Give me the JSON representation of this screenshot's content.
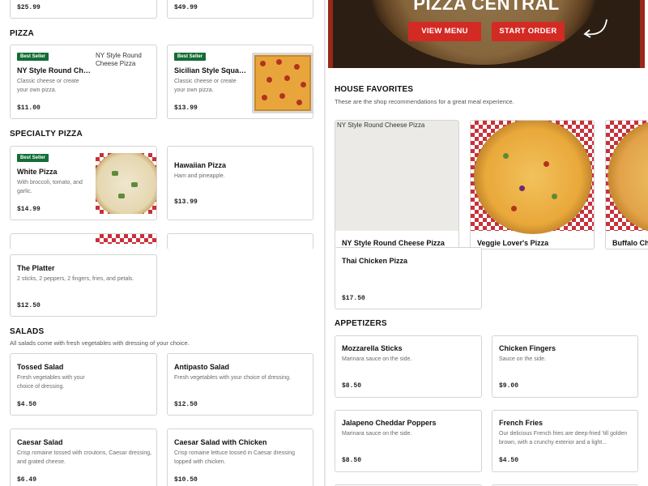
{
  "top_row": {
    "price_left": "$25.99",
    "price_right": "$49.99"
  },
  "pizza": {
    "title": "PIZZA",
    "items": [
      {
        "badge": "Best Seller",
        "name": "NY Style Round Chee...",
        "desc": "Classic cheese or create your own pizza.",
        "price": "$11.00",
        "img_alt": "NY Style Round Cheese Pizza"
      },
      {
        "badge": "Best Seller",
        "name": "Sicilian Style Square...",
        "desc": "Classic cheese or create your own pizza.",
        "price": "$13.99"
      }
    ]
  },
  "specialty": {
    "title": "SPECIALTY PIZZA",
    "items": [
      {
        "badge": "Best Seller",
        "name": "White Pizza",
        "desc": "With broccoli, tomato, and garlic.",
        "price": "$14.99"
      },
      {
        "name": "Hawaiian Pizza",
        "desc": "Ham and pineapple.",
        "price": "$13.99"
      },
      {
        "name": "The Platter",
        "desc": "2 sticks, 2 peppers, 2 fingers, fries, and petals.",
        "price": "$12.50"
      }
    ]
  },
  "salads": {
    "title": "SALADS",
    "subtitle": "All salads come with fresh vegetables with dressing of your choice.",
    "items": [
      {
        "name": "Tossed Salad",
        "desc": "Fresh vegetables with your choice of dressing.",
        "price": "$4.50"
      },
      {
        "name": "Antipasto Salad",
        "desc": "Fresh vegetables with your choice of dressing.",
        "price": "$12.50"
      },
      {
        "name": "Caesar Salad",
        "desc": "Crisp romaine tossed with croutons, Caesar dressing, and grated cheese.",
        "price": "$6.49"
      },
      {
        "name": "Caesar Salad with Chicken",
        "desc": "Crisp romaine lettuce tossed in Caesar dressing topped with chicken.",
        "price": "$10.50"
      }
    ]
  },
  "hero": {
    "title": "PIZZA CENTRAL",
    "view_menu": "VIEW MENU",
    "start_order": "START ORDER"
  },
  "favorites": {
    "title": "HOUSE FAVORITES",
    "subtitle": "These are the shop recommendations for a great meal experience.",
    "items": [
      {
        "name": "NY Style Round Cheese Pizza",
        "img_alt": "NY Style Round Cheese Pizza"
      },
      {
        "name": "Veggie Lover's Pizza"
      },
      {
        "name": "Buffalo Ch..."
      }
    ]
  },
  "thai": {
    "name": "Thai Chicken Pizza",
    "price": "$17.50"
  },
  "appetizers": {
    "title": "APPETIZERS",
    "items": [
      {
        "name": "Mozzarella Sticks",
        "desc": "Marinara sauce on the side.",
        "price": "$8.50"
      },
      {
        "name": "Chicken Fingers",
        "desc": "Sauce on the side.",
        "price": "$9.00"
      },
      {
        "name": "Jalapeno Cheddar Poppers",
        "desc": "Marinara sauce on the side.",
        "price": "$8.50"
      },
      {
        "name": "French Fries",
        "desc": "Our delicious French fries are deep-fried 'till golden brown, with a crunchy exterior and a light...",
        "price": "$4.50"
      }
    ]
  }
}
